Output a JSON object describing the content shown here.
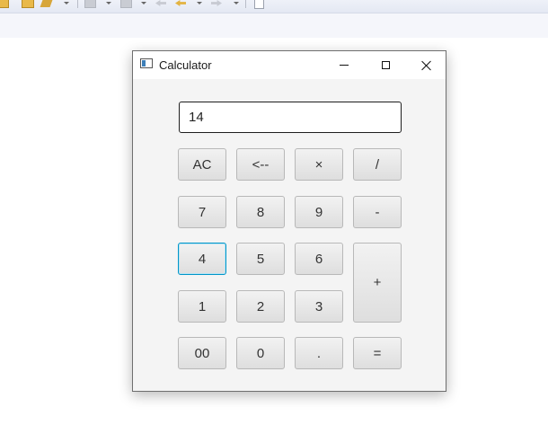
{
  "window": {
    "title": "Calculator"
  },
  "display": {
    "value": "14"
  },
  "keys": {
    "clear": "AC",
    "backspace": "<--",
    "multiply": "×",
    "divide": "/",
    "seven": "7",
    "eight": "8",
    "nine": "9",
    "minus": "-",
    "four": "4",
    "five": "5",
    "six": "6",
    "plus": "+",
    "one": "1",
    "two": "2",
    "three": "3",
    "double_zero": "00",
    "zero": "0",
    "decimal": ".",
    "equals": "="
  },
  "focused_key": "four",
  "colors": {
    "focus_ring": "#0096c9",
    "window_bg": "#f4f4f4"
  },
  "icons": {
    "app": "calculator-app-icon",
    "minimize": "minimize-icon",
    "maximize": "maximize-icon",
    "close": "close-icon"
  }
}
